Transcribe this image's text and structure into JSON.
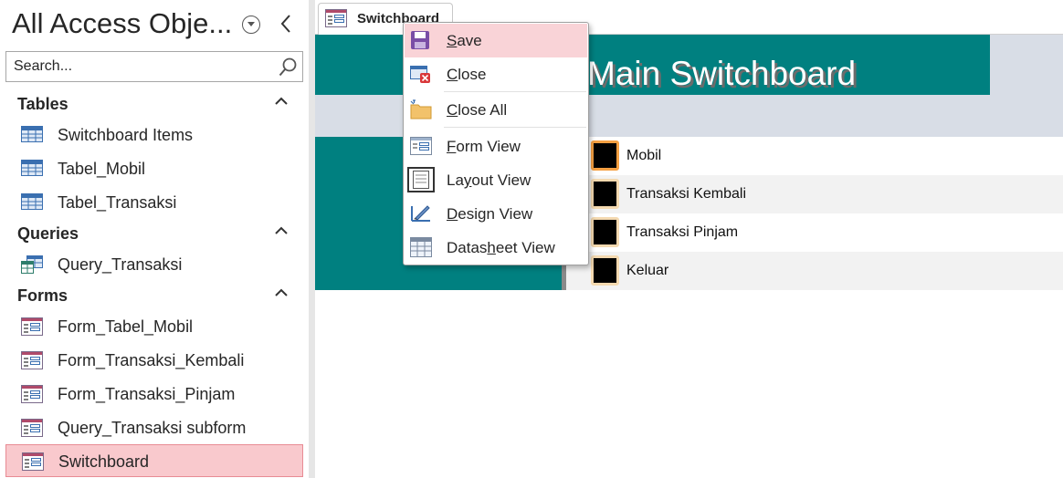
{
  "nav": {
    "title": "All Access Obje...",
    "search_placeholder": "Search...",
    "groups": [
      {
        "label": "Tables",
        "items": [
          "Switchboard Items",
          "Tabel_Mobil",
          "Tabel_Transaksi"
        ]
      },
      {
        "label": "Queries",
        "items": [
          "Query_Transaksi"
        ]
      },
      {
        "label": "Forms",
        "items": [
          "Form_Tabel_Mobil",
          "Form_Transaksi_Kembali",
          "Form_Transaksi_Pinjam",
          "Query_Transaksi subform",
          "Switchboard"
        ]
      }
    ],
    "selected_item": "Switchboard"
  },
  "document": {
    "tab_label": "Switchboard",
    "form_title": "Main Switchboard",
    "switchboard_items": [
      "Mobil",
      "Transaksi Kembali",
      "Transaksi Pinjam",
      "Keluar"
    ]
  },
  "context_menu": {
    "items": [
      {
        "pre": "",
        "key": "S",
        "post": "ave"
      },
      {
        "pre": "",
        "key": "C",
        "post": "lose"
      },
      {
        "pre": "",
        "key": "C",
        "post": "lose All"
      },
      {
        "pre": "",
        "key": "F",
        "post": "orm View"
      },
      {
        "pre": "La",
        "key": "y",
        "post": "out View"
      },
      {
        "pre": "",
        "key": "D",
        "post": "esign View"
      },
      {
        "pre": "Datas",
        "key": "h",
        "post": "eet View"
      }
    ]
  },
  "colors": {
    "accent_teal": "#008080",
    "selection_pink": "#f9c9cd",
    "header_gray": "#d8dde6",
    "focus_orange": "#f5a042"
  },
  "icons": {
    "table": "table-icon",
    "query": "query-icon",
    "form": "form-icon",
    "save": "save-icon",
    "close": "close-document-icon",
    "close_all": "close-all-icon",
    "form_view": "form-view-icon",
    "layout_view": "layout-view-icon",
    "design_view": "design-view-icon",
    "datasheet_view": "datasheet-view-icon"
  }
}
